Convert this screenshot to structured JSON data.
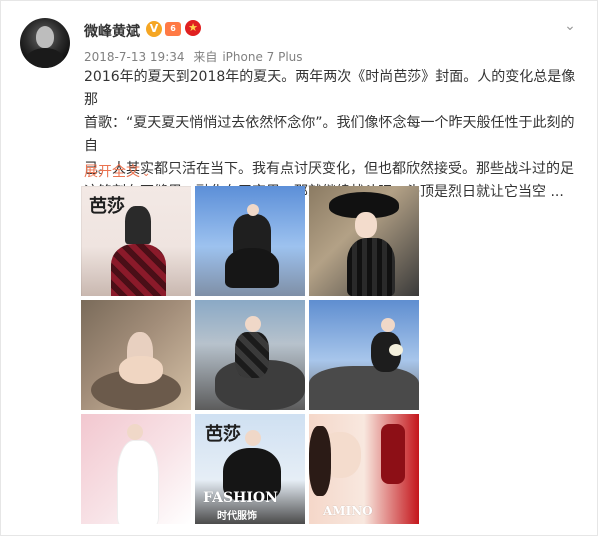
{
  "post": {
    "username": "微峰黄斌",
    "verified_badge": "V",
    "level_badge": "6",
    "star_badge": "★",
    "timestamp": "2018-7-13 19:34",
    "source_prefix": "来自",
    "source_device": "iPhone 7 Plus",
    "text_line_1": "2016年的夏天到2018年的夏天。两年两次《时尚芭莎》封面。人的变化总是像那",
    "text_line_2": "首歌：“夏天夏天悄悄过去依然怀念你”。我们像怀念每一个昨天般任性于此刻的自",
    "text_line_3": "己。人其实都只活在当下。我有点讨厌变化，但也都欣然接受。那些战斗过的足",
    "text_line_4": "迹铭刻在石缝里，融化在天空里。那就继续战斗吧。头顶是烈日就让它当空 ...",
    "expand_label": "展开全文",
    "expand_icon": "chevron-down",
    "menu_icon": "chevron-down"
  },
  "images": [
    {
      "id": "img-1",
      "overlay": "芭莎"
    },
    {
      "id": "img-2",
      "overlay": ""
    },
    {
      "id": "img-3",
      "overlay": ""
    },
    {
      "id": "img-4",
      "overlay": ""
    },
    {
      "id": "img-5",
      "overlay": ""
    },
    {
      "id": "img-6",
      "overlay": ""
    },
    {
      "id": "img-7",
      "overlay": ""
    },
    {
      "id": "img-8",
      "overlay": "芭莎",
      "overlay_2": "FASHION",
      "overlay_3": "时代服饰"
    },
    {
      "id": "img-9",
      "overlay": "AMINO"
    }
  ],
  "colors": {
    "link": "#eb7350",
    "meta": "#808080",
    "text": "#333333"
  }
}
